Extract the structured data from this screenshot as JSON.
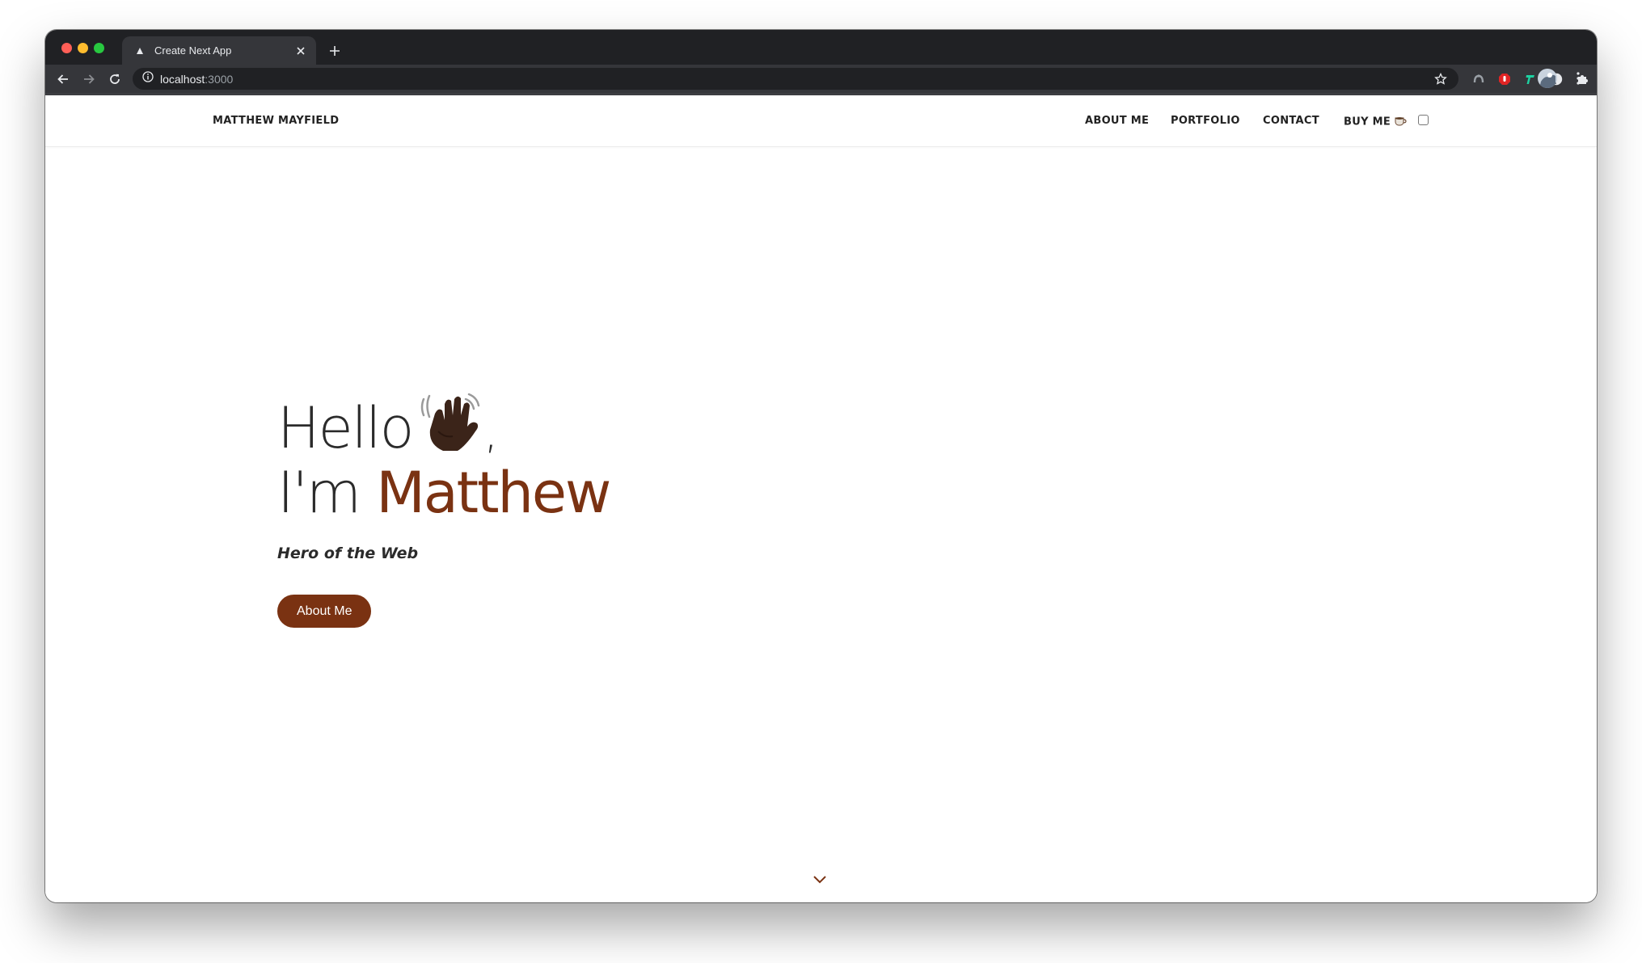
{
  "browser": {
    "tab": {
      "title": "Create Next App"
    },
    "address": {
      "host": "localhost",
      "port": ":3000"
    }
  },
  "header": {
    "brand": "MATTHEW MAYFIELD",
    "nav": [
      {
        "label": "ABOUT ME"
      },
      {
        "label": "PORTFOLIO"
      },
      {
        "label": "CONTACT"
      },
      {
        "label": "BUY ME",
        "icon": "coffee-icon"
      }
    ],
    "theme_toggle": {
      "checked": false
    }
  },
  "hero": {
    "greeting": "Hello",
    "greeting_icon": "waving-hand-icon",
    "greeting_punct": ",",
    "intro": "I'm",
    "name": "Matthew",
    "tagline": "Hero of the Web",
    "cta_label": "About Me"
  },
  "colors": {
    "accent": "#7a3212",
    "chrome_dark": "#202124",
    "chrome_toolbar": "#35363a"
  }
}
